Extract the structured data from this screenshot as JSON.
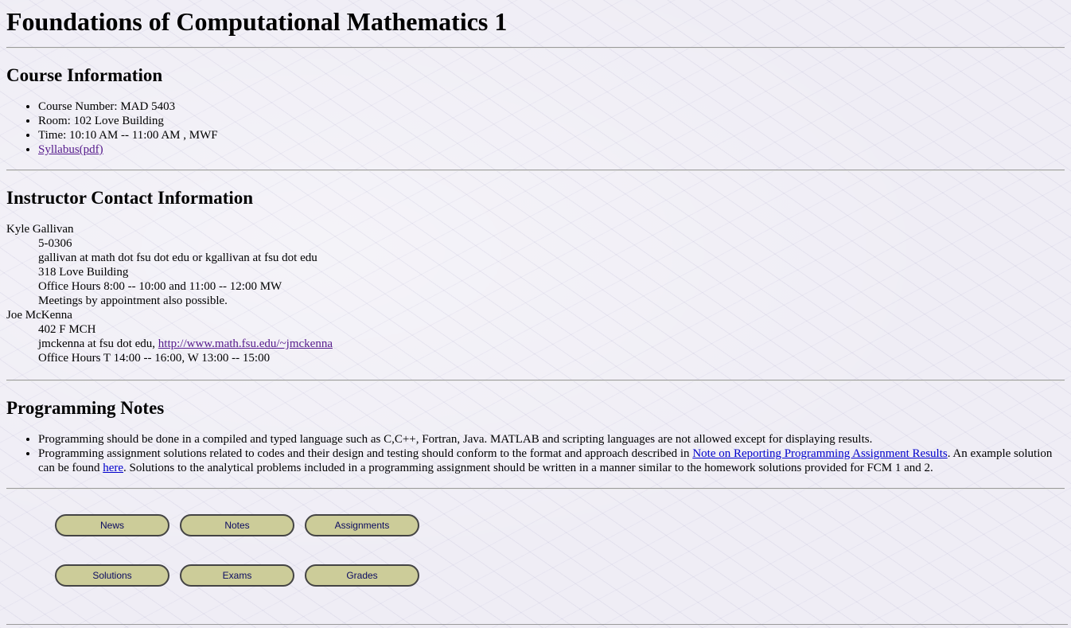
{
  "page_title": "Foundations of Computational Mathematics 1",
  "course_info": {
    "heading": "Course Information",
    "items": [
      "Course Number: MAD 5403",
      "Room: 102 Love Building",
      "Time: 10:10 AM -- 11:00 AM , MWF"
    ],
    "syllabus_link": "Syllabus(pdf)"
  },
  "instructors": {
    "heading": "Instructor Contact Information",
    "gallivan": {
      "name": "Kyle Gallivan",
      "details": [
        "5-0306",
        "gallivan at math dot fsu dot edu or kgallivan at fsu dot edu",
        "318 Love Building",
        "Office Hours 8:00 -- 10:00 and 11:00 -- 12:00 MW",
        "Meetings by appointment also possible."
      ]
    },
    "mckenna": {
      "name": "Joe McKenna",
      "room": "402 F MCH",
      "email_text": "jmckenna at fsu dot edu, ",
      "homepage_link": "http://www.math.fsu.edu/~jmckenna",
      "office_hours": "Office Hours T 14:00 -- 16:00, W 13:00 -- 15:00"
    }
  },
  "programming_notes": {
    "heading": "Programming Notes",
    "note1": "Programming should be done in a compiled and typed language such as C,C++, Fortran, Java. MATLAB and scripting languages are not allowed except for displaying results.",
    "note2_part1": "Programming assignment solutions related to codes and their design and testing should conform to the format and approach described in ",
    "note2_link": "Note on Reporting Programming Assignment Results",
    "note2_part2": ". An example solution can be found ",
    "note2_here_link": "here",
    "note2_part3": ". Solutions to the analytical problems included in a programming assignment should be written in a manner similar to the homework solutions provided for FCM 1 and 2."
  },
  "nav_buttons": {
    "news": "News",
    "notes": "Notes",
    "assignments": "Assignments",
    "solutions": "Solutions",
    "exams": "Exams",
    "grades": "Grades"
  },
  "colors": {
    "background": "#efedf5",
    "button_fill": "#cccc99",
    "button_text": "#0a0a60",
    "link": "#0000cc",
    "visited_link": "#551a8b"
  }
}
